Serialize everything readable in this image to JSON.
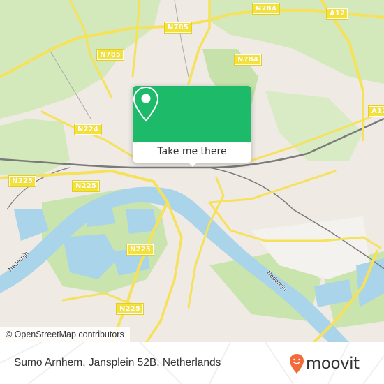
{
  "map": {
    "attribution": "© OpenStreetMap contributors",
    "road_labels": [
      {
        "text": "N784",
        "id": "n784-north"
      },
      {
        "text": "A12",
        "id": "a12-north"
      },
      {
        "text": "N785",
        "id": "n785-center"
      },
      {
        "text": "N785",
        "id": "n785-west"
      },
      {
        "text": "N784",
        "id": "n784-center"
      },
      {
        "text": "A12",
        "id": "a12-east"
      },
      {
        "text": "N224",
        "id": "n224"
      },
      {
        "text": "N225",
        "id": "n225-west"
      },
      {
        "text": "N225",
        "id": "n225-center"
      },
      {
        "text": "N225",
        "id": "n225-south"
      },
      {
        "text": "N225",
        "id": "n225-southwest"
      }
    ],
    "river_labels": [
      {
        "text": "Nederrijn",
        "id": "nederrijn-west"
      },
      {
        "text": "Nederrijn",
        "id": "nederrijn-east"
      }
    ],
    "colors": {
      "land": "#efeae4",
      "green": "#cfe8b4",
      "water": "#a9d4ea",
      "road": "#f6e15a",
      "rail": "#777777"
    }
  },
  "popup": {
    "button_label": "Take me there",
    "icon": "map-pin-icon",
    "color": "#1dba6a"
  },
  "footer": {
    "address": "Sumo Arnhem, Jansplein 52B, Netherlands",
    "brand": "moovit",
    "brand_color": "#f26b3a"
  }
}
